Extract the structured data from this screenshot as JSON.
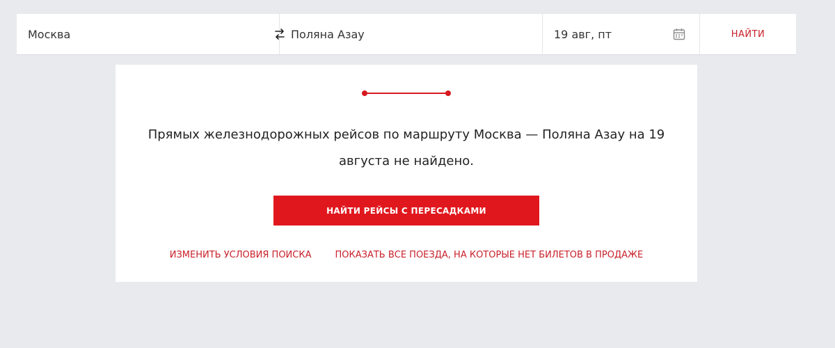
{
  "search": {
    "from": "Москва",
    "to": "Поляна Азау",
    "date": "19 авг, пт",
    "find_label": "НАЙТИ"
  },
  "result": {
    "message": "Прямых железнодорожных рейсов по маршруту Москва — Поляна Азау на 19 августа не найдено.",
    "primary_button": "НАЙТИ РЕЙСЫ С ПЕРЕСАДКАМИ",
    "link_change": "ИЗМЕНИТЬ УСЛОВИЯ ПОИСКА",
    "link_show_all": "ПОКАЗАТЬ ВСЕ ПОЕЗДА, НА КОТОРЫЕ НЕТ БИЛЕТОВ В ПРОДАЖЕ"
  },
  "icons": {
    "swap": "swap-arrows-icon",
    "calendar": "calendar-icon",
    "route": "route-line-icon"
  },
  "colors": {
    "accent": "#e0181e",
    "link": "#c8202a",
    "background": "#e9eaee"
  }
}
